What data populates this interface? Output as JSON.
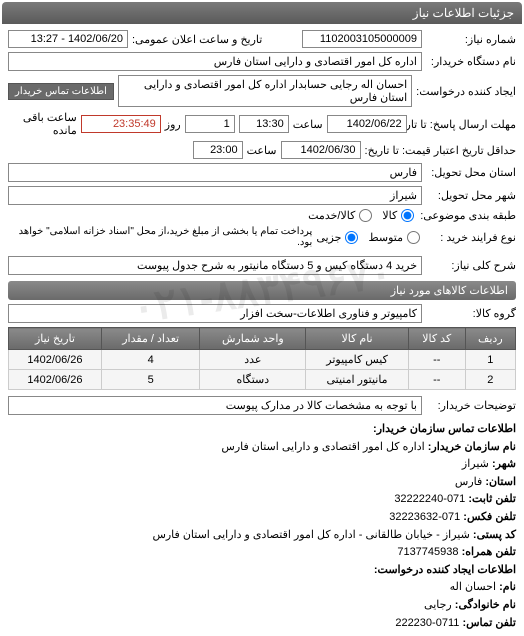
{
  "watermark": "۰۲۱-۸۸۳۴۹۶۷۰",
  "titlebar": "جزئیات اطلاعات نیاز",
  "fields": {
    "number_label": "شماره نیاز:",
    "number_value": "1102003105000009",
    "public_datetime_label": "تاریخ و ساعت اعلان عمومی:",
    "public_datetime_value": "1402/06/20 - 13:27",
    "buyer_label": "نام دستگاه خریدار:",
    "buyer_value": "اداره کل امور اقتصادی و دارایی استان فارس",
    "requester_label": "ایجاد کننده درخواست:",
    "requester_value": "احسان اله  رجایی حسابدار اداره کل امور اقتصادی و دارایی استان فارس",
    "contact_link": "اطلاعات تماس خریدار",
    "deadline_label": "مهلت ارسال پاسخ: تا تاریخ:",
    "deadline_date": "1402/06/22",
    "time_label": "ساعت",
    "deadline_time": "13:30",
    "day_label": "روز",
    "days_remaining": "1",
    "countdown": "23:35:49",
    "remaining_label": "ساعت باقی مانده",
    "valid_label": "حداقل تاریخ اعتبار قیمت: تا تاریخ:",
    "valid_date": "1402/06/30",
    "valid_time": "23:00",
    "province_label": "استان محل تحویل:",
    "province_value": "فارس",
    "city_label": "شهر محل تحویل:",
    "city_value": "شیراز",
    "group_type_label": "طبقه بندی موضوعی:",
    "group_goods": "کالا",
    "group_service": "کالا/خدمت",
    "pay_type_label": "نوع فرایند خرید :",
    "pay_medium": "متوسط",
    "pay_partial": "جزیی",
    "pay_note": "پرداخت تمام یا بخشی از مبلغ خرید،از محل \"اسناد خزانه اسلامی\" خواهد بود.",
    "desc_label": "شرح کلی نیاز:",
    "desc_value": "خرید 4 دستگاه کیس و 5 دستگاه مانیتور به شرح جدول پیوست"
  },
  "goods_section": "اطلاعات کالاهای مورد نیاز",
  "group_label": "گروه کالا:",
  "group_value": "کامپیوتر و فناوری اطلاعات-سخت افزار",
  "table": {
    "headers": [
      "ردیف",
      "کد کالا",
      "نام کالا",
      "واحد شمارش",
      "تعداد / مقدار",
      "تاریخ نیاز"
    ],
    "rows": [
      [
        "1",
        "--",
        "کیس کامپیوتر",
        "عدد",
        "4",
        "1402/06/26"
      ],
      [
        "2",
        "--",
        "مانیتور امنیتی",
        "دستگاه",
        "5",
        "1402/06/26"
      ]
    ]
  },
  "buyer_note_label": "توضیحات خریدار:",
  "buyer_note_value": "با توجه به مشخصات کالا در مدارک پیوست",
  "contact_section": "اطلاعات تماس سازمان خریدار:",
  "contact": {
    "org_label": "نام سازمان خریدار:",
    "org_value": "اداره کل امور اقتصادی و دارایی استان فارس",
    "city_label": "شهر:",
    "city_value": "شیراز",
    "province_label": "استان:",
    "province_value": "فارس",
    "phone_label": "تلفن ثابت:",
    "phone_value": "071-32222240",
    "fax_label": "تلفن فکس:",
    "fax_value": "071-32223632",
    "address_label": "کد پستی:",
    "address_value": "شیراز - خیابان طالقانی - اداره کل امور اقتصادی و دارایی استان فارس",
    "postal_label": "تلفن همراه:",
    "postal_value": "7137745938",
    "creator_section": "اطلاعات ایجاد کننده درخواست:",
    "name_label": "نام:",
    "name_value": "احسان اله",
    "family_label": "نام خانوادگی:",
    "family_value": "رجایی",
    "creator_phone_label": "تلفن تماس:",
    "creator_phone_value": "0711-222230"
  }
}
